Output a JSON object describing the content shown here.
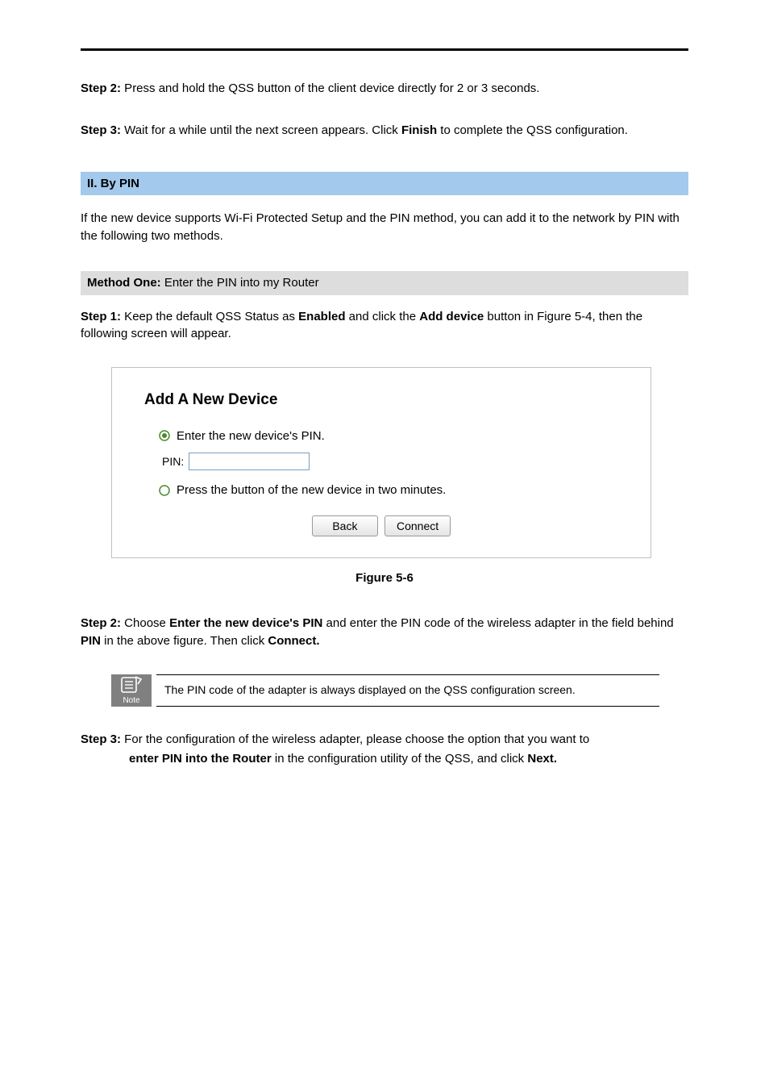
{
  "step2_a": {
    "label": "Step 2:",
    "text": " Press and hold the QSS button of the client device directly for 2 or 3 seconds."
  },
  "step3_a": {
    "label": "Step 3:",
    "text_before": " Wait for a while until the next screen appears. Click ",
    "bold": "Finish",
    "text_after": " to complete the QSS configuration."
  },
  "heading_bypin": "II.   By PIN",
  "bypin_intro": "If the new device supports Wi-Fi Protected Setup and the PIN method, you can add it to the network by PIN with the following two methods.",
  "method_one_label": "Method One:",
  "method_one_text": " Enter the PIN into my Router",
  "step1_b": {
    "label": "Step 1:",
    "text_before": " Keep the default QSS Status as ",
    "bold1": "Enabled",
    "mid": " and click the ",
    "bold2": "Add device",
    "text_after": " button in Figure 5-4, then the following screen will appear."
  },
  "figure": {
    "title": "Add A New Device",
    "radio1": "Enter the new device's PIN.",
    "pin_label": "PIN:",
    "radio2": "Press the button of the new device in two minutes.",
    "back_btn": "Back",
    "connect_btn": "Connect",
    "caption": "Figure 5-6"
  },
  "step2_b": {
    "label": "Step 2:",
    "text1_before": " Choose ",
    "bold1": "Enter the new device's PIN",
    "text1_after": " and enter the PIN code of the wireless adapter in the field behind ",
    "bold2": "PIN",
    "text2_mid": " in the above figure. Then click ",
    "bold3": "Connect."
  },
  "note": {
    "label": "Note",
    "text": "The PIN code of the adapter is always displayed on the QSS configuration screen."
  },
  "step3_b": {
    "label": "Step 3:",
    "line1": " For the configuration of the wireless adapter, please choose the option that you want to",
    "bold1": "enter PIN into the Router",
    "mid": " in the configuration utility of the QSS, and click ",
    "bold2": "Next."
  }
}
